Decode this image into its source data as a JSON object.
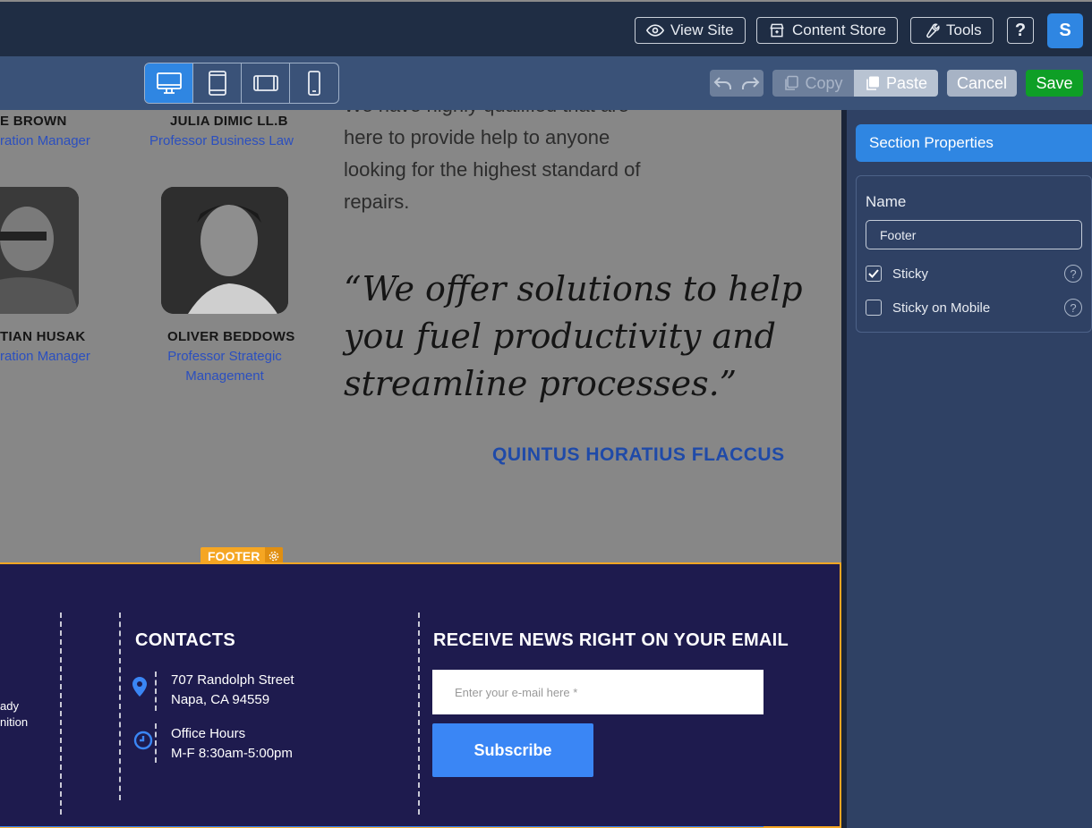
{
  "topbar": {
    "view_site": "View Site",
    "content_store": "Content Store",
    "tools": "Tools",
    "help": "?",
    "avatar": "S"
  },
  "toolbar": {
    "copy": "Copy",
    "paste": "Paste",
    "cancel": "Cancel",
    "save": "Save"
  },
  "canvas": {
    "people": [
      {
        "name": "E BROWN",
        "role": "ration Manager"
      },
      {
        "name": "JULIA DIMIC LL.B",
        "role": "Professor Business Law"
      },
      {
        "name": "TIAN HUSAK",
        "role": "ration Manager"
      },
      {
        "name": "OLIVER BEDDOWS",
        "role_line1": "Professor Strategic",
        "role_line2": "Management"
      }
    ],
    "body_lines": [
      "We have highly qualified that are",
      "here to provide help to anyone",
      "looking for the highest standard of",
      "repairs."
    ],
    "quote_lines": [
      "“We offer solutions to help",
      "you fuel productivity and",
      "streamline processes.”"
    ],
    "author": "QUINTUS HORATIUS FLACCUS",
    "footer_tag": "FOOTER",
    "footer": {
      "left_line1": "ady",
      "left_line2": "nition",
      "contacts_heading": "CONTACTS",
      "address_line1": "707 Randolph Street",
      "address_line2": "Napa, CA 94559",
      "hours_line1": "Office Hours",
      "hours_line2": "M-F 8:30am-5:00pm",
      "news_heading": "RECEIVE NEWS RIGHT ON YOUR EMAIL",
      "email_placeholder": "Enter your e-mail here *",
      "subscribe": "Subscribe"
    }
  },
  "panel": {
    "section_title": "Section Properties",
    "name_label": "Name",
    "name_value": "Footer",
    "sticky_label": "Sticky",
    "sticky_checked": true,
    "sticky_mobile_label": "Sticky on Mobile",
    "sticky_mobile_checked": false,
    "help": "?"
  },
  "colors": {
    "accent": "#2f86e2",
    "save": "#0e9f26",
    "footer_border": "#f5a623",
    "footer_bg": "#1e1b4e"
  }
}
